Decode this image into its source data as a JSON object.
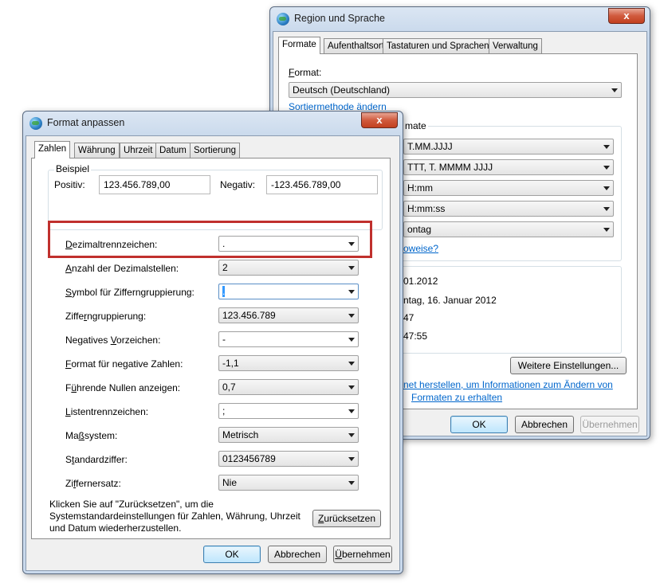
{
  "region_window": {
    "title": "Region und Sprache",
    "close_label": "x",
    "tabs": [
      "Formate",
      "Aufenthaltsort",
      "Tastaturen und Sprachen",
      "Verwaltung"
    ],
    "format_label": "Format:",
    "format_value": "Deutsch (Deutschland)",
    "sort_link": "Sortiermethode ändern",
    "group_title_fragment": "mate",
    "date_combos": [
      "T.MM.JJJJ",
      "TTT, T. MMMM JJJJ",
      "H:mm",
      "H:mm:ss",
      "ontag"
    ],
    "link_fragment": "oweise?",
    "preview_lines": [
      "01.2012",
      "ntag, 16. Januar 2012",
      "47",
      "47:55"
    ],
    "more_settings_button": "Weitere Einstellungen...",
    "info_link_line1": "net herstellen, um Informationen zum Ändern von",
    "info_link_line2": "Formaten zu erhalten",
    "ok_button": "OK",
    "cancel_button": "Abbrechen",
    "apply_button": "Übernehmen"
  },
  "format_window": {
    "title": "Format anpassen",
    "close_label": "x",
    "tabs": [
      "Zahlen",
      "Währung",
      "Uhrzeit",
      "Datum",
      "Sortierung"
    ],
    "example_group": "Beispiel",
    "positive_label": "Positiv:",
    "positive_value": "123.456.789,00",
    "negative_label": "Negativ:",
    "negative_value": "-123.456.789,00",
    "settings": [
      {
        "label": "Dezimaltrennzeichen:",
        "value": "."
      },
      {
        "label": "Anzahl der Dezimalstellen:",
        "value": "2"
      },
      {
        "label": "Symbol für Zifferngruppierung:",
        "value": "."
      },
      {
        "label": "Zifferngruppierung:",
        "value": "123.456.789"
      },
      {
        "label": "Negatives Vorzeichen:",
        "value": "-"
      },
      {
        "label": "Format für negative Zahlen:",
        "value": "-1,1"
      },
      {
        "label": "Führende Nullen anzeigen:",
        "value": "0,7"
      },
      {
        "label": "Listentrennzeichen:",
        "value": ";"
      },
      {
        "label": "Maßsystem:",
        "value": "Metrisch"
      },
      {
        "label": "Standardziffer:",
        "value": "0123456789"
      },
      {
        "label": "Ziffernersatz:",
        "value": "Nie"
      }
    ],
    "reset_text_line1": "Klicken Sie auf \"Zurücksetzen\", um die",
    "reset_text_line2": "Systemstandardeinstellungen für Zahlen, Währung, Uhrzeit",
    "reset_text_line3": "und Datum wiederherzustellen.",
    "reset_button": "Zurücksetzen",
    "ok_button": "OK",
    "cancel_button": "Abbrechen",
    "apply_button": "Übernehmen"
  },
  "colors": {
    "highlight_box": "#c0302d",
    "link": "#0066cc",
    "close_button": "#c2401f"
  }
}
